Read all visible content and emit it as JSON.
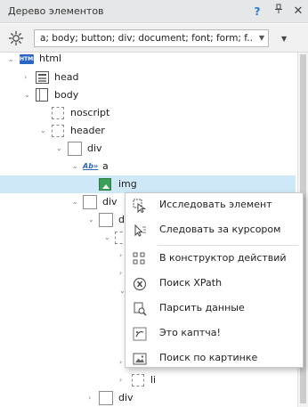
{
  "panel": {
    "title": "Дерево элементов",
    "help_icon": "?",
    "pin_icon": "pin-icon",
    "close_icon": "✕"
  },
  "filter": {
    "value": "a; body; button; div; document; font; form; f..."
  },
  "tree": {
    "html": "html",
    "head": "head",
    "body": "body",
    "noscript": "noscript",
    "header": "header",
    "div1": "div",
    "a": "a",
    "img": "img",
    "div2": "div",
    "div3_partial": "di",
    "li": "li",
    "div_bottom": "div"
  },
  "context_menu": {
    "items": [
      {
        "label": "Исследовать элемент",
        "icon": "inspect-cursor-icon"
      },
      {
        "label": "Следовать за курсором",
        "icon": "follow-cursor-icon"
      },
      {
        "label": "В конструктор действий",
        "icon": "action-builder-icon"
      },
      {
        "label": "Поиск XPath",
        "icon": "xpath-icon"
      },
      {
        "label": "Парсить данные",
        "icon": "parse-data-icon"
      },
      {
        "label": "Это каптча!",
        "icon": "captcha-icon"
      },
      {
        "label": "Поиск по картинке",
        "icon": "image-search-icon"
      }
    ]
  },
  "colors": {
    "selection": "#cfe8f7",
    "accent": "#2b66c4",
    "titlebar": "#e6e7e8"
  }
}
